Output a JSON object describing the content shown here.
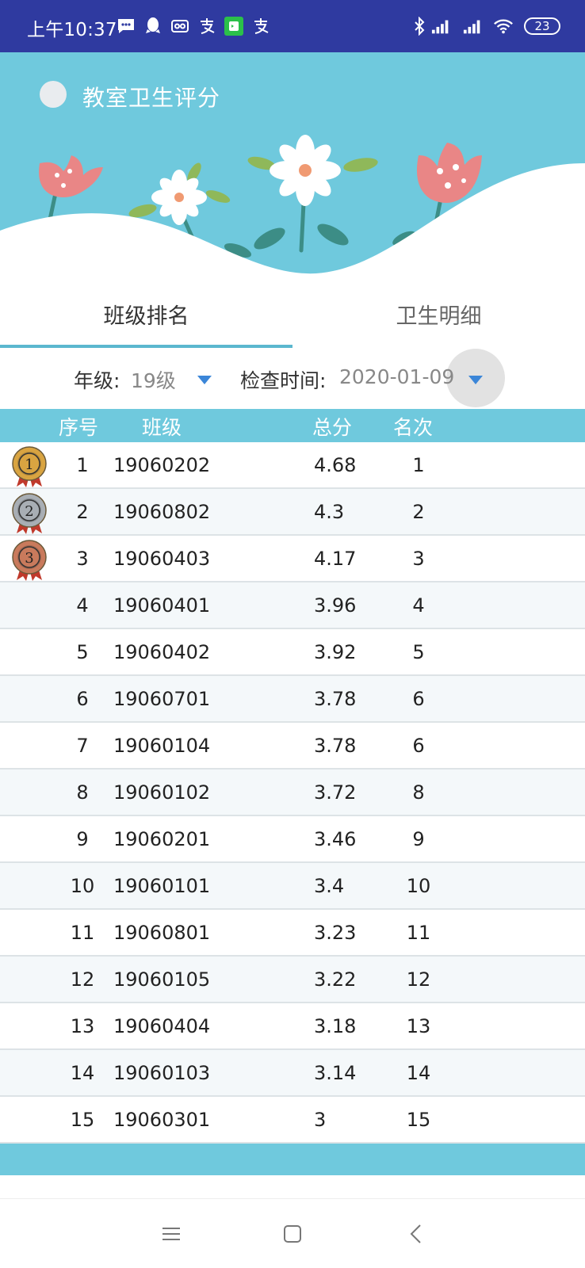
{
  "status_bar": {
    "time": "上午10:37",
    "battery": "23"
  },
  "header": {
    "title": "教室卫生评分"
  },
  "tabs": [
    {
      "label": "班级排名",
      "active": true
    },
    {
      "label": "卫生明细",
      "active": false
    }
  ],
  "filters": {
    "grade_label": "年级:",
    "grade_value": "19级",
    "date_label": "检查时间:",
    "date_value": "2020-01-09"
  },
  "table": {
    "headers": {
      "index": "序号",
      "class": "班级",
      "score": "总分",
      "rank": "名次"
    },
    "rows": [
      {
        "index": "1",
        "class": "19060202",
        "score": "4.68",
        "rank": "1",
        "medal": "1"
      },
      {
        "index": "2",
        "class": "19060802",
        "score": "4.3",
        "rank": "2",
        "medal": "2"
      },
      {
        "index": "3",
        "class": "19060403",
        "score": "4.17",
        "rank": "3",
        "medal": "3"
      },
      {
        "index": "4",
        "class": "19060401",
        "score": "3.96",
        "rank": "4"
      },
      {
        "index": "5",
        "class": "19060402",
        "score": "3.92",
        "rank": "5"
      },
      {
        "index": "6",
        "class": "19060701",
        "score": "3.78",
        "rank": "6"
      },
      {
        "index": "7",
        "class": "19060104",
        "score": "3.78",
        "rank": "6"
      },
      {
        "index": "8",
        "class": "19060102",
        "score": "3.72",
        "rank": "8"
      },
      {
        "index": "9",
        "class": "19060201",
        "score": "3.46",
        "rank": "9"
      },
      {
        "index": "10",
        "class": "19060101",
        "score": "3.4",
        "rank": "10"
      },
      {
        "index": "11",
        "class": "19060801",
        "score": "3.23",
        "rank": "11"
      },
      {
        "index": "12",
        "class": "19060105",
        "score": "3.22",
        "rank": "12"
      },
      {
        "index": "13",
        "class": "19060404",
        "score": "3.18",
        "rank": "13"
      },
      {
        "index": "14",
        "class": "19060103",
        "score": "3.14",
        "rank": "14"
      },
      {
        "index": "15",
        "class": "19060301",
        "score": "3",
        "rank": "15"
      }
    ]
  },
  "colors": {
    "status_bar": "#2f3aa0",
    "accent": "#6fc9dd",
    "tab_indicator": "#5bb7cf",
    "dropdown_arrow": "#3b86d8",
    "medal_gold": "#d9a441",
    "medal_silver": "#a8aeb4",
    "medal_bronze": "#c97a5c"
  },
  "icons": {
    "status": [
      "message-icon",
      "qq-icon",
      "voicemail-icon",
      "alipay-icon",
      "wechat-icon",
      "alipay-icon",
      "bluetooth-icon",
      "signal-icon",
      "signal-icon",
      "wifi-icon"
    ],
    "nav": [
      "menu-icon",
      "home-icon",
      "back-icon"
    ]
  }
}
